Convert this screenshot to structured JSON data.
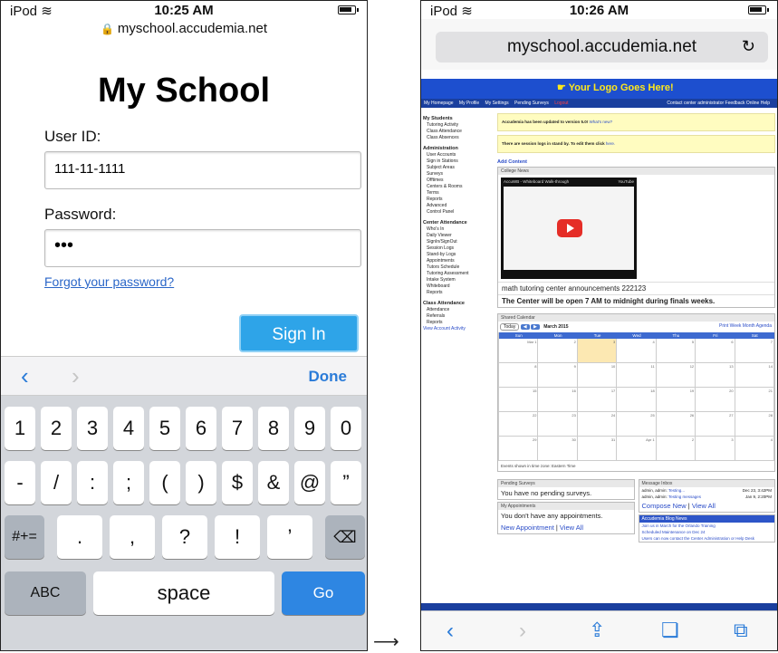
{
  "left": {
    "status": {
      "carrier": "iPod",
      "time": "10:25 AM"
    },
    "url": "myschool.accudemia.net",
    "title": "My School",
    "user_label": "User ID:",
    "user_value": "111-11-1111",
    "pw_label": "Password:",
    "pw_value": "•••",
    "forgot": "Forgot your password?",
    "signin": "Sign In",
    "done": "Done",
    "keys_row1": [
      "1",
      "2",
      "3",
      "4",
      "5",
      "6",
      "7",
      "8",
      "9",
      "0"
    ],
    "keys_row2": [
      "-",
      "/",
      ":",
      ";",
      "(",
      ")",
      "$",
      "&",
      "@",
      "”"
    ],
    "key_sym": "#+=",
    "keys_row3": [
      ".",
      ",",
      "?",
      "!",
      "’"
    ],
    "key_abc": "ABC",
    "key_space": "space",
    "key_go": "Go"
  },
  "right": {
    "status": {
      "carrier": "iPod",
      "time": "10:26 AM"
    },
    "url": "myschool.accudemia.net",
    "logo": "Your Logo Goes Here!",
    "nav": [
      "My Homepage",
      "My Profile",
      "My Settings",
      "Pending Surveys"
    ],
    "logout": "Logout",
    "nav_right": "Contact center administrator   Feedback   Online Help",
    "sidebar": [
      {
        "h": "My Students",
        "items": [
          "Tutoring Activity",
          "Class Attendance",
          "Class Absences"
        ]
      },
      {
        "h": "Administration",
        "items": [
          "User Accounts",
          "Sign in Stations",
          "Subject Areas",
          "Surveys",
          "Offtimes",
          "Centers & Rooms",
          "Terms",
          "Reports",
          "Advanced",
          "Control Panel"
        ]
      },
      {
        "h": "Center Attendance",
        "items": [
          "Who's In",
          "Daily Viewer",
          "SignIn/SignOut",
          "Session Logs",
          "Stand-by Logs",
          "Appointments",
          "Tutors Schedule",
          "Tutoring Assessment",
          "Intake System",
          "Whiteboard",
          "Reports"
        ]
      },
      {
        "h": "Class Attendance",
        "items": [
          "Attendance",
          "Referrals",
          "Reports"
        ]
      }
    ],
    "view_activity": "View Account Activity",
    "notice1": "Accudemia has been updated to version 5.0!",
    "notice1_link": "What's new?",
    "notice2": "There are session logs in stand by. To edit them click",
    "notice2_link": "here.",
    "add_content": "Add Content",
    "college_news": "College News",
    "video_title": "AccuWB - Whiteboard Walk-through",
    "video_src": "YouTube",
    "ann1": "math tutoring center announcements 222123",
    "ann2": "The Center will be open 7 AM to midnight during finals weeks.",
    "shared_cal": "Shared Calendar",
    "cal_today": "Today",
    "cal_month": "March 2015",
    "cal_views": "Print  Week  Month  Agenda",
    "days": [
      "Sun",
      "Mon",
      "Tue",
      "Wed",
      "Thu",
      "Fri",
      "Sat"
    ],
    "cal_dates": [
      "Mar 1",
      "2",
      "3",
      "4",
      "5",
      "6",
      "7",
      "8",
      "9",
      "10",
      "11",
      "12",
      "13",
      "14",
      "15",
      "16",
      "17",
      "18",
      "19",
      "20",
      "21",
      "22",
      "23",
      "24",
      "25",
      "26",
      "27",
      "28",
      "29",
      "30",
      "31",
      "Apr 1",
      "2",
      "3",
      "4"
    ],
    "tz": "Events shown in time zone: Eastern Time",
    "pending_h": "Pending Surveys",
    "pending_text": "You have no pending surveys.",
    "appt_h": "My Appointments",
    "appt_text": "You don't have any appointments.",
    "appt_new": "New Appointment",
    "appt_all": "View All",
    "msg_h": "Message Inbox",
    "msg_rows": [
      {
        "from": "admin, admin:",
        "subj": "Testing...",
        "date": "Dec 23, 3:42PM"
      },
      {
        "from": "admin, admin:",
        "subj": "Testing messages",
        "date": "Jan 9, 2:20PM"
      }
    ],
    "compose": "Compose New",
    "view_all": "View All",
    "blog_h": "Accudemia Blog News",
    "blog_items": [
      "Join us in March for the Orlando Training",
      "Scheduled Maintenance on Dec 24",
      "Users can now contact the Center Administration or Help Desk"
    ]
  }
}
